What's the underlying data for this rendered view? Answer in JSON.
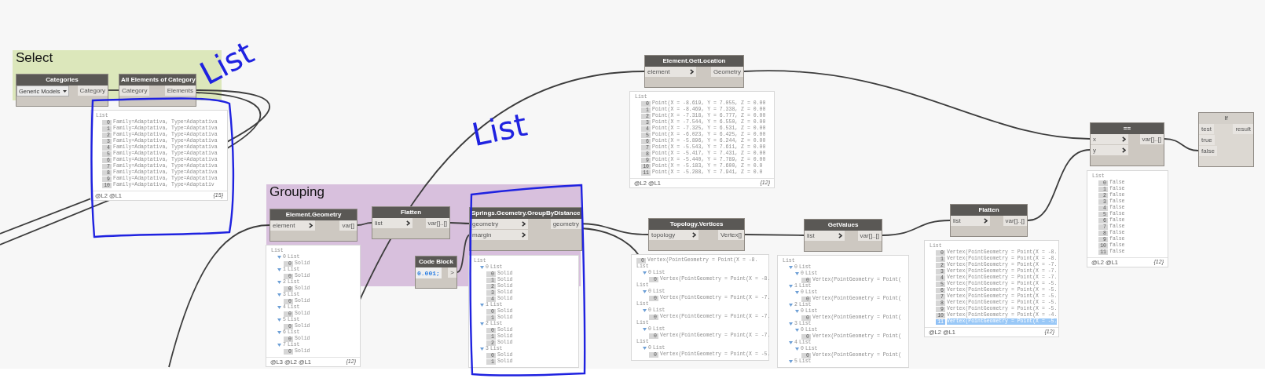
{
  "groups": [
    {
      "title": "Select",
      "color": "#dce7bb"
    },
    {
      "title": "Grouping",
      "color": "#d8c0dd"
    }
  ],
  "nodes": [
    {
      "kind": "dropdown",
      "title": "Categories",
      "value": "Generic Models",
      "outputs": [
        "Category"
      ]
    },
    {
      "kind": "node",
      "title": "All Elements of Category",
      "inputs": [
        {
          "label": "Category",
          "chevron": false
        }
      ],
      "outputs": [
        "Elements"
      ]
    },
    {
      "kind": "node",
      "title": "Element.Geometry",
      "inputs": [
        {
          "label": "element",
          "chevron": true
        }
      ],
      "outputs": [
        "var[]"
      ]
    },
    {
      "kind": "node",
      "title": "Flatten",
      "inputs": [
        {
          "label": "list",
          "chevron": true
        }
      ],
      "outputs": [
        "var[]..[]"
      ]
    },
    {
      "kind": "code",
      "title": "Code Block",
      "code": "0.001;",
      "outputs": [
        ">"
      ]
    },
    {
      "kind": "node",
      "title": "Springs.Geometry.GroupByDistance",
      "inputs": [
        {
          "label": "geometry",
          "chevron": true
        },
        {
          "label": "margin",
          "chevron": true
        }
      ],
      "outputs": [
        "geometry"
      ]
    },
    {
      "kind": "node",
      "title": "Element.GetLocation",
      "inputs": [
        {
          "label": "element",
          "chevron": true
        }
      ],
      "outputs": [
        "Geometry"
      ]
    },
    {
      "kind": "node",
      "title": "Topology.Vertices",
      "inputs": [
        {
          "label": "topology",
          "chevron": true
        }
      ],
      "outputs": [
        "Vertex[]"
      ]
    },
    {
      "kind": "node",
      "title": "GetValues",
      "inputs": [
        {
          "label": "list",
          "chevron": true
        }
      ],
      "outputs": [
        "var[]..[]"
      ]
    },
    {
      "kind": "node",
      "title": "Flatten",
      "inputs": [
        {
          "label": "list",
          "chevron": true
        }
      ],
      "outputs": [
        "var[]..[]"
      ]
    },
    {
      "kind": "node",
      "title": "==",
      "inputs": [
        {
          "label": "x",
          "chevron": true
        },
        {
          "label": "y",
          "chevron": true
        }
      ],
      "outputs": [
        "var[]..[]"
      ]
    },
    {
      "kind": "light",
      "title": "If",
      "inputs": [
        {
          "label": "test",
          "chevron": false
        },
        {
          "label": "true",
          "chevron": false
        },
        {
          "label": "false",
          "chevron": false
        }
      ],
      "outputs": [
        "result"
      ]
    }
  ],
  "watches": [
    {
      "items": [
        {
          "kind": "list",
          "text": "List",
          "children": [
            {
              "kind": "item",
              "index": "0",
              "text": "Family=Adaptativa, Type=Adaptativa"
            },
            {
              "kind": "item",
              "index": "1",
              "text": "Family=Adaptativa, Type=Adaptativa"
            },
            {
              "kind": "item",
              "index": "2",
              "text": "Family=Adaptativa, Type=Adaptativa"
            },
            {
              "kind": "item",
              "index": "3",
              "text": "Family=Adaptativa, Type=Adaptativa"
            },
            {
              "kind": "item",
              "index": "4",
              "text": "Family=Adaptativa, Type=Adaptativa"
            },
            {
              "kind": "item",
              "index": "5",
              "text": "Family=Adaptativa, Type=Adaptativa"
            },
            {
              "kind": "item",
              "index": "6",
              "text": "Family=Adaptativa, Type=Adaptativa"
            },
            {
              "kind": "item",
              "index": "7",
              "text": "Family=Adaptativa, Type=Adaptativa"
            },
            {
              "kind": "item",
              "index": "8",
              "text": "Family=Adaptativa, Type=Adaptativa"
            },
            {
              "kind": "item",
              "index": "9",
              "text": "Family=Adaptativa, Type=Adaptativa"
            },
            {
              "kind": "item",
              "index": "10",
              "text": "Family=Adaptativa, Type=Adaptativ"
            }
          ]
        }
      ],
      "footer": "@L2 @L1",
      "count": "{15}"
    },
    {
      "items": [
        {
          "kind": "list",
          "text": "List",
          "children": [
            {
              "kind": "list",
              "index": "0",
              "text": "List",
              "children": [
                {
                  "kind": "item",
                  "index": "0",
                  "text": "Solid"
                }
              ]
            },
            {
              "kind": "list",
              "index": "1",
              "text": "List",
              "children": [
                {
                  "kind": "item",
                  "index": "0",
                  "text": "Solid"
                }
              ]
            },
            {
              "kind": "list",
              "index": "2",
              "text": "List",
              "children": [
                {
                  "kind": "item",
                  "index": "0",
                  "text": "Solid"
                }
              ]
            },
            {
              "kind": "list",
              "index": "3",
              "text": "List",
              "children": [
                {
                  "kind": "item",
                  "index": "0",
                  "text": "Solid"
                }
              ]
            },
            {
              "kind": "list",
              "index": "4",
              "text": "List",
              "children": [
                {
                  "kind": "item",
                  "index": "0",
                  "text": "Solid"
                }
              ]
            },
            {
              "kind": "list",
              "index": "5",
              "text": "List",
              "children": [
                {
                  "kind": "item",
                  "index": "0",
                  "text": "Solid"
                }
              ]
            },
            {
              "kind": "list",
              "index": "6",
              "text": "List",
              "children": [
                {
                  "kind": "item",
                  "index": "0",
                  "text": "Solid"
                }
              ]
            },
            {
              "kind": "list",
              "index": "7",
              "text": "List",
              "children": [
                {
                  "kind": "item",
                  "index": "0",
                  "text": "Solid"
                }
              ]
            }
          ]
        }
      ],
      "footer": "@L3 @L2 @L1",
      "count": "{12}"
    },
    {
      "items": [
        {
          "kind": "list",
          "text": "List",
          "children": [
            {
              "kind": "list",
              "index": "0",
              "text": "List",
              "children": [
                {
                  "kind": "item",
                  "index": "0",
                  "text": "Solid"
                },
                {
                  "kind": "item",
                  "index": "1",
                  "text": "Solid"
                },
                {
                  "kind": "item",
                  "index": "2",
                  "text": "Solid"
                },
                {
                  "kind": "item",
                  "index": "3",
                  "text": "Solid"
                },
                {
                  "kind": "item",
                  "index": "4",
                  "text": "Solid"
                }
              ]
            },
            {
              "kind": "list",
              "index": "1",
              "text": "List",
              "children": [
                {
                  "kind": "item",
                  "index": "0",
                  "text": "Solid"
                },
                {
                  "kind": "item",
                  "index": "1",
                  "text": "Solid"
                }
              ]
            },
            {
              "kind": "list",
              "index": "2",
              "text": "List",
              "children": [
                {
                  "kind": "item",
                  "index": "0",
                  "text": "Solid"
                },
                {
                  "kind": "item",
                  "index": "1",
                  "text": "Solid"
                },
                {
                  "kind": "item",
                  "index": "2",
                  "text": "Solid"
                }
              ]
            },
            {
              "kind": "list",
              "index": "3",
              "text": "List",
              "children": [
                {
                  "kind": "item",
                  "index": "0",
                  "text": "Solid"
                },
                {
                  "kind": "item",
                  "index": "1",
                  "text": "Solid"
                }
              ]
            }
          ]
        }
      ]
    },
    {
      "items": [
        {
          "kind": "list",
          "text": "List",
          "children": [
            {
              "kind": "item",
              "index": "0",
              "text": "Point(X = -8.619, Y = 7.055, Z = 0.00"
            },
            {
              "kind": "item",
              "index": "1",
              "text": "Point(X = -8.469, Y = 7.338, Z = 0.00"
            },
            {
              "kind": "item",
              "index": "2",
              "text": "Point(X = -7.318, Y = 6.777, Z = 0.00"
            },
            {
              "kind": "item",
              "index": "3",
              "text": "Point(X = -7.544, Y = 6.550, Z = 0.00"
            },
            {
              "kind": "item",
              "index": "4",
              "text": "Point(X = -7.325, Y = 6.531, Z = 0.00"
            },
            {
              "kind": "item",
              "index": "5",
              "text": "Point(X = -6.023, Y = 6.425, Z = 0.00"
            },
            {
              "kind": "item",
              "index": "6",
              "text": "Point(X = -5.896, Y = 6.244, Z = 0.00"
            },
            {
              "kind": "item",
              "index": "7",
              "text": "Point(X = -5.543, Y = 7.611, Z = 0.00"
            },
            {
              "kind": "item",
              "index": "8",
              "text": "Point(X = -5.417, Y = 7.431, Z = 0.00"
            },
            {
              "kind": "item",
              "index": "9",
              "text": "Point(X = -5.440, Y = 7.789, Z = 0.00"
            },
            {
              "kind": "item",
              "index": "10",
              "text": "Point(X = -5.183, Y = 7.600, Z = 0.0"
            },
            {
              "kind": "item",
              "index": "11",
              "text": "Point(X = -5.288, Y = 7.941, Z = 0.0"
            }
          ]
        }
      ],
      "footer": "@L2 @L1",
      "count": "{12}"
    },
    {
      "items": [
        {
          "kind": "item",
          "index": "0",
          "text": "Vertex(PointGeometry = Point(X = -8."
        },
        {
          "kind": "list",
          "text": "List",
          "children": [
            {
              "kind": "list",
              "index": "0",
              "text": "List",
              "children": [
                {
                  "kind": "item",
                  "index": "0",
                  "text": "Vertex(PointGeometry = Point(X = -8."
                }
              ]
            }
          ]
        },
        {
          "kind": "list",
          "text": "List",
          "children": [
            {
              "kind": "list",
              "index": "0",
              "text": "List",
              "children": [
                {
                  "kind": "item",
                  "index": "0",
                  "text": "Vertex(PointGeometry = Point(X = -7."
                }
              ]
            }
          ]
        },
        {
          "kind": "list",
          "text": "List",
          "children": [
            {
              "kind": "list",
              "index": "0",
              "text": "List",
              "children": [
                {
                  "kind": "item",
                  "index": "0",
                  "text": "Vertex(PointGeometry = Point(X = -7."
                }
              ]
            }
          ]
        },
        {
          "kind": "list",
          "text": "List",
          "children": [
            {
              "kind": "list",
              "index": "0",
              "text": "List",
              "children": [
                {
                  "kind": "item",
                  "index": "0",
                  "text": "Vertex(PointGeometry = Point(X = -7."
                }
              ]
            }
          ]
        },
        {
          "kind": "list",
          "text": "List",
          "children": [
            {
              "kind": "list",
              "index": "0",
              "text": "List",
              "children": [
                {
                  "kind": "item",
                  "index": "0",
                  "text": "Vertex(PointGeometry = Point(X = -5."
                }
              ]
            }
          ]
        }
      ]
    },
    {
      "items": [
        {
          "kind": "list",
          "text": "List",
          "children": [
            {
              "kind": "list",
              "index": "0",
              "text": "List",
              "children": [
                {
                  "kind": "list",
                  "index": "0",
                  "text": "List",
                  "children": [
                    {
                      "kind": "item",
                      "index": "0",
                      "text": "Vertex(PointGeometry = Point("
                    }
                  ]
                }
              ]
            },
            {
              "kind": "list",
              "index": "1",
              "text": "List",
              "children": [
                {
                  "kind": "list",
                  "index": "0",
                  "text": "List",
                  "children": [
                    {
                      "kind": "item",
                      "index": "0",
                      "text": "Vertex(PointGeometry = Point("
                    }
                  ]
                }
              ]
            },
            {
              "kind": "list",
              "index": "2",
              "text": "List",
              "children": [
                {
                  "kind": "list",
                  "index": "0",
                  "text": "List",
                  "children": [
                    {
                      "kind": "item",
                      "index": "0",
                      "text": "Vertex(PointGeometry = Point("
                    }
                  ]
                }
              ]
            },
            {
              "kind": "list",
              "index": "3",
              "text": "List",
              "children": [
                {
                  "kind": "list",
                  "index": "0",
                  "text": "List",
                  "children": [
                    {
                      "kind": "item",
                      "index": "0",
                      "text": "Vertex(PointGeometry = Point("
                    }
                  ]
                }
              ]
            },
            {
              "kind": "list",
              "index": "4",
              "text": "List",
              "children": [
                {
                  "kind": "list",
                  "index": "0",
                  "text": "List",
                  "children": [
                    {
                      "kind": "item",
                      "index": "0",
                      "text": "Vertex(PointGeometry = Point("
                    }
                  ]
                }
              ]
            },
            {
              "kind": "list",
              "index": "5",
              "text": "List"
            }
          ]
        }
      ]
    },
    {
      "items": [
        {
          "kind": "list",
          "text": "List",
          "children": [
            {
              "kind": "item",
              "index": "0",
              "text": "Vertex(PointGeometry = Point(X = -8.",
              "selected": false
            },
            {
              "kind": "item",
              "index": "1",
              "text": "Vertex(PointGeometry = Point(X = -8.",
              "selected": false
            },
            {
              "kind": "item",
              "index": "2",
              "text": "Vertex(PointGeometry = Point(X = -7.",
              "selected": false
            },
            {
              "kind": "item",
              "index": "3",
              "text": "Vertex(PointGeometry = Point(X = -7.",
              "selected": false
            },
            {
              "kind": "item",
              "index": "4",
              "text": "Vertex(PointGeometry = Point(X = -7.",
              "selected": false
            },
            {
              "kind": "item",
              "index": "5",
              "text": "Vertex(PointGeometry = Point(X = -5.",
              "selected": false
            },
            {
              "kind": "item",
              "index": "6",
              "text": "Vertex(PointGeometry = Point(X = -5.",
              "selected": false
            },
            {
              "kind": "item",
              "index": "7",
              "text": "Vertex(PointGeometry = Point(X = -5.",
              "selected": false
            },
            {
              "kind": "item",
              "index": "8",
              "text": "Vertex(PointGeometry = Point(X = -5.",
              "selected": false
            },
            {
              "kind": "item",
              "index": "9",
              "text": "Vertex(PointGeometry = Point(X = -5.",
              "selected": false
            },
            {
              "kind": "item",
              "index": "10",
              "text": "Vertex(PointGeometry = Point(X = -4.",
              "selected": false
            },
            {
              "kind": "item",
              "index": "11",
              "text": "Vertex(PointGeometry = Point(X = -5.",
              "selected": true
            }
          ]
        }
      ],
      "footer": "@L2 @L1",
      "count": "{12}"
    },
    {
      "items": [
        {
          "kind": "list",
          "text": "List",
          "children": [
            {
              "kind": "item",
              "index": "0",
              "text": "false"
            },
            {
              "kind": "item",
              "index": "1",
              "text": "false"
            },
            {
              "kind": "item",
              "index": "2",
              "text": "false"
            },
            {
              "kind": "item",
              "index": "3",
              "text": "false"
            },
            {
              "kind": "item",
              "index": "4",
              "text": "false"
            },
            {
              "kind": "item",
              "index": "5",
              "text": "false"
            },
            {
              "kind": "item",
              "index": "6",
              "text": "false"
            },
            {
              "kind": "item",
              "index": "7",
              "text": "false"
            },
            {
              "kind": "item",
              "index": "8",
              "text": "false"
            },
            {
              "kind": "item",
              "index": "9",
              "text": "false"
            },
            {
              "kind": "item",
              "index": "10",
              "text": "false"
            },
            {
              "kind": "item",
              "index": "11",
              "text": "false"
            }
          ]
        }
      ],
      "footer": "@L2 @L1",
      "count": "{12}"
    }
  ],
  "annotations": [
    {
      "text": "List"
    },
    {
      "text": "List"
    }
  ]
}
